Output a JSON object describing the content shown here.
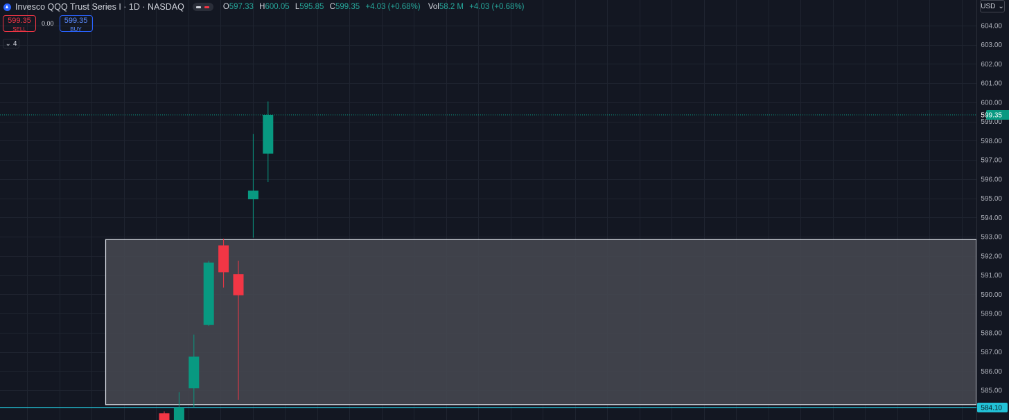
{
  "header": {
    "title": "Invesco QQQ Trust Series I · 1D · NASDAQ",
    "ohlc": {
      "o_label": "O",
      "o": "597.33",
      "h_label": "H",
      "h": "600.05",
      "l_label": "L",
      "l": "595.85",
      "c_label": "C",
      "c": "599.35",
      "change": "+4.03 (+0.68%)",
      "vol_label": "Vol",
      "vol": "58.2 M",
      "vol_change": "+4.03 (+0.68%)"
    }
  },
  "trade": {
    "sell_price": "599.35",
    "sell_label": "SELL",
    "spread": "0.00",
    "buy_price": "599.35",
    "buy_label": "BUY"
  },
  "indicators": {
    "count": "4",
    "icon": "chevron-down-icon"
  },
  "currency": {
    "label": "USD",
    "icon": "chevron-down-icon"
  },
  "colors": {
    "background": "#131722",
    "up": "#089981",
    "down": "#f23645",
    "grid": "#1f2430",
    "zone_fill": "#454850",
    "zone_border": "#e0e3eb",
    "last_price": "#089981",
    "support_line": "#22c1d6",
    "axis_text": "#b2b5be"
  },
  "chart_data": {
    "type": "candlestick",
    "ylim": [
      583.5,
      605.0
    ],
    "y_ticks": [
      "585.00",
      "586.00",
      "587.00",
      "588.00",
      "589.00",
      "590.00",
      "591.00",
      "592.00",
      "593.00",
      "594.00",
      "595.00",
      "596.00",
      "597.00",
      "598.00",
      "599.00",
      "600.00",
      "601.00",
      "602.00",
      "603.00",
      "604.00"
    ],
    "candles": [
      {
        "open": 583.8,
        "high": 583.9,
        "low": 583.0,
        "close": 583.0
      },
      {
        "open": 583.2,
        "high": 584.9,
        "low": 583.0,
        "close": 584.1
      },
      {
        "open": 585.1,
        "high": 587.9,
        "low": 584.1,
        "close": 586.75
      },
      {
        "open": 588.4,
        "high": 591.75,
        "low": 588.35,
        "close": 591.65
      },
      {
        "open": 592.55,
        "high": 592.9,
        "low": 590.35,
        "close": 591.15
      },
      {
        "open": 591.05,
        "high": 591.75,
        "low": 584.5,
        "close": 589.95
      },
      {
        "open": 594.95,
        "high": 598.35,
        "low": 592.95,
        "close": 595.4
      },
      {
        "open": 597.33,
        "high": 600.05,
        "low": 595.85,
        "close": 599.35
      }
    ],
    "last_price": "599.35",
    "support_price": "584.10",
    "zone": {
      "top": 592.85,
      "bottom": 584.25
    }
  }
}
